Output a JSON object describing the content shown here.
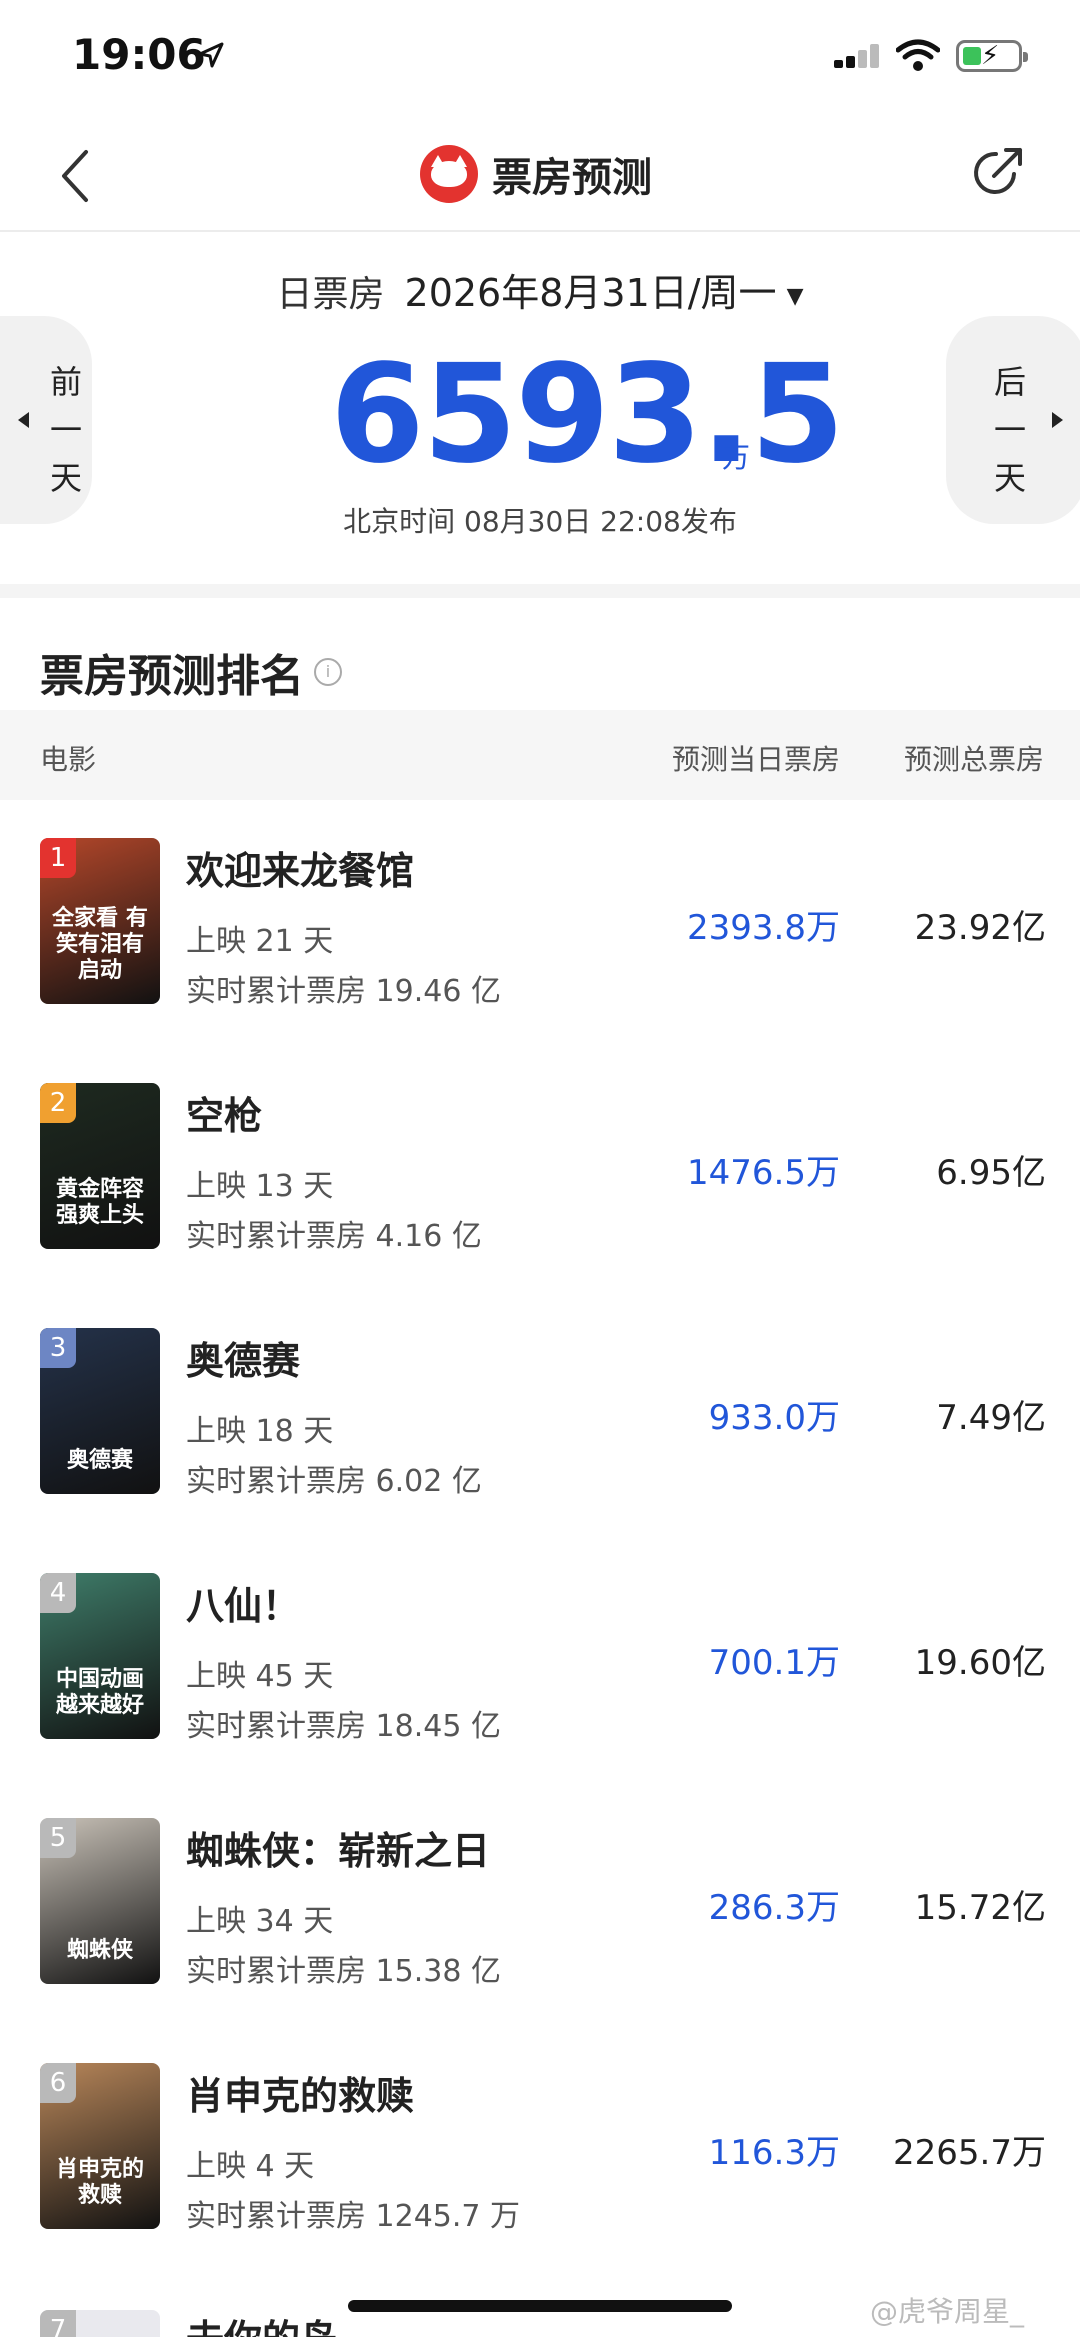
{
  "status": {
    "time": "19:06"
  },
  "nav": {
    "title": "票房预测"
  },
  "date_header": {
    "label": "日票房",
    "date": "2026年8月31日/周一",
    "prev_label": "前一天",
    "next_label": "后一天",
    "big_value": "6593.5",
    "big_unit": "万",
    "publish_info": "北京时间 08月30日 22:08发布"
  },
  "ranking": {
    "title": "票房预测排名",
    "col_movie": "电影",
    "col_day": "预测当日票房",
    "col_total": "预测总票房",
    "items": [
      {
        "rank": "1",
        "title": "欢迎来龙餐馆",
        "days": "上映 21 天",
        "cumulative": "实时累计票房 19.46 亿",
        "day_forecast": "2393.8万",
        "total_forecast": "23.92亿",
        "badge_color": "#e3332f",
        "poster_color": "#b4472a",
        "poster_text": "全家看 有笑有泪有启动"
      },
      {
        "rank": "2",
        "title": "空枪",
        "days": "上映 13 天",
        "cumulative": "实时累计票房 4.16 亿",
        "day_forecast": "1476.5万",
        "total_forecast": "6.95亿",
        "badge_color": "#f0a030",
        "poster_color": "#1e2a20",
        "poster_text": "黄金阵容 强爽上头"
      },
      {
        "rank": "3",
        "title": "奥德赛",
        "days": "上映 18 天",
        "cumulative": "实时累计票房 6.02 亿",
        "day_forecast": "933.0万",
        "total_forecast": "7.49亿",
        "badge_color": "#6d86c4",
        "poster_color": "#24324a",
        "poster_text": "奥德赛"
      },
      {
        "rank": "4",
        "title": "八仙！",
        "days": "上映 45 天",
        "cumulative": "实时累计票房 18.45 亿",
        "day_forecast": "700.1万",
        "total_forecast": "19.60亿",
        "badge_color": "#b9b9b9",
        "poster_color": "#3f7d6a",
        "poster_text": "中国动画 越来越好"
      },
      {
        "rank": "5",
        "title": "蜘蛛侠：崭新之日",
        "days": "上映 34 天",
        "cumulative": "实时累计票房 15.38 亿",
        "day_forecast": "286.3万",
        "total_forecast": "15.72亿",
        "badge_color": "#b9b9b9",
        "poster_color": "#c9c2b8",
        "poster_text": "蜘蛛侠"
      },
      {
        "rank": "6",
        "title": "肖申克的救赎",
        "days": "上映 4 天",
        "cumulative": "实时累计票房 1245.7 万",
        "day_forecast": "116.3万",
        "total_forecast": "2265.7万",
        "badge_color": "#b9b9b9",
        "poster_color": "#b9875a",
        "poster_text": "肖申克的救赎"
      }
    ],
    "partial_item": {
      "rank": "7",
      "title": "去你的岛"
    }
  },
  "watermark": "@虎爷周星_"
}
